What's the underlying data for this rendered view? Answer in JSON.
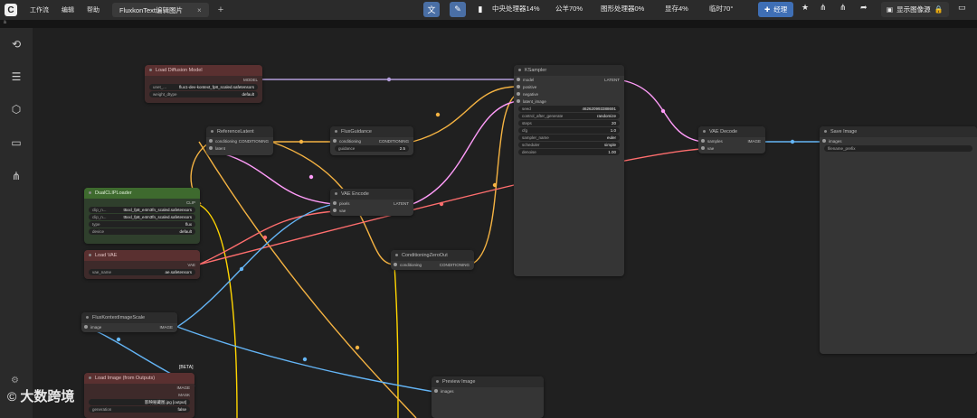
{
  "topbar": {
    "logo_letter": "C",
    "menu": [
      "工作流",
      "编辑",
      "帮助"
    ],
    "tab_title": "FluxkonText编辑图片",
    "tab_close": "×",
    "tab_add": "+",
    "stats": {
      "cpu": "中央处理器14%",
      "ram": "公羊70%",
      "gpu": "图形处理器0%",
      "vram": "显存4%",
      "temp": "临时70°"
    },
    "queue_label": "经理",
    "image_source_label": "显示图像源"
  },
  "subbar": {
    "label": "ä"
  },
  "sidebar": {
    "icons": [
      "history-icon",
      "queue-list-icon",
      "model-cube-icon",
      "folder-icon",
      "workflow-tree-icon"
    ]
  },
  "nodes": {
    "load_diffusion": {
      "title": "Load Diffusion Model",
      "output": "MODEL",
      "unet_label": "unet_...",
      "unet_value": "flux1-dev-kontext_fp8_scaled.safetensors",
      "dtype_label": "weight_dtype",
      "dtype_value": "default"
    },
    "reference_latent": {
      "title": "ReferenceLatent",
      "in_conditioning": "conditioning",
      "out_conditioning": "CONDITIONING",
      "in_latent": "latent"
    },
    "flux_guidance": {
      "title": "FluxGuidance",
      "in_conditioning": "conditioning",
      "out_conditioning": "CONDITIONING",
      "guidance_label": "guidance",
      "guidance_value": "2.5"
    },
    "dual_clip": {
      "title": "DualCLIPLoader",
      "output": "CLIP",
      "clip1_label": "clip_n...",
      "clip1_value": "t5xxl_fp8_e4m3fn_scaled.safetensors",
      "clip2_label": "clip_n...",
      "clip2_value": "t5xxl_fp8_e4m3fn_scaled.safetensors",
      "type_label": "type",
      "type_value": "flux",
      "device_label": "device",
      "device_value": "default"
    },
    "vae_encode": {
      "title": "VAE Encode",
      "in_pixels": "pixels",
      "out_latent": "LATENT",
      "in_vae": "vae"
    },
    "load_vae": {
      "title": "Load VAE",
      "output": "VAE",
      "vae_label": "vae_name",
      "vae_value": "ae.safetensors"
    },
    "conditioning_zero": {
      "title": "ConditioningZeroOut",
      "in_conditioning": "conditioning",
      "out_conditioning": "CONDITIONING"
    },
    "ksampler": {
      "title": "KSampler",
      "in_model": "model",
      "out_latent": "LATENT",
      "in_positive": "positive",
      "in_negative": "negative",
      "in_latent_image": "latent_image",
      "widgets": [
        {
          "label": "seed",
          "value": "462620993388691"
        },
        {
          "label": "control_after_generate",
          "value": "randomize"
        },
        {
          "label": "steps",
          "value": "20"
        },
        {
          "label": "cfg",
          "value": "1.0"
        },
        {
          "label": "sampler_name",
          "value": "euler"
        },
        {
          "label": "scheduler",
          "value": "simple"
        },
        {
          "label": "denoise",
          "value": "1.00"
        }
      ]
    },
    "vae_decode": {
      "title": "VAE Decode",
      "in_samples": "samples",
      "out_image": "IMAGE",
      "in_vae": "vae"
    },
    "save_image": {
      "title": "Save Image",
      "in_images": "images",
      "prefix_label": "filename_prefix"
    },
    "flux_kontext_scale": {
      "title": "FluxKontextImageScale",
      "in_image": "image",
      "out_image": "IMAGE"
    },
    "load_image_outputs": {
      "title": "Load Image (from Outputs)",
      "beta": "[BETA]",
      "out_image": "IMAGE",
      "out_mask": "MASK",
      "image_value": "影映秘藏图.jpg [output]",
      "auto_label": "generation",
      "auto_value": "false"
    },
    "preview_image": {
      "title": "Preview Image",
      "in_images": "images"
    }
  },
  "watermark": {
    "logo": "©",
    "text": "大数跨境"
  },
  "colors": {
    "model_link": "#b39ddb",
    "conditioning_link": "#f5b342",
    "latent_link": "#ff9cf9",
    "vae_link": "#ff6e6e",
    "image_link": "#64b5f6",
    "clip_link": "#ffd500"
  }
}
